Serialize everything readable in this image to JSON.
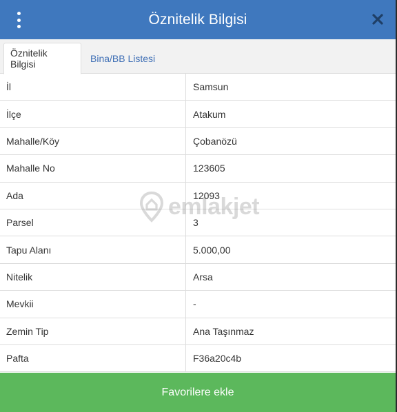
{
  "header": {
    "title": "Öznitelik Bilgisi",
    "menu_icon": "vertical-dots-icon",
    "close_icon": "close-icon",
    "color": "#3f78be"
  },
  "tabs": [
    {
      "label": "Öznitelik Bilgisi",
      "active": true
    },
    {
      "label": "Bina/BB Listesi",
      "active": false
    }
  ],
  "attributes": [
    {
      "label": "İl",
      "value": "Samsun"
    },
    {
      "label": "İlçe",
      "value": "Atakum"
    },
    {
      "label": "Mahalle/Köy",
      "value": "Çobanözü"
    },
    {
      "label": "Mahalle No",
      "value": "123605"
    },
    {
      "label": "Ada",
      "value": "12093"
    },
    {
      "label": "Parsel",
      "value": "3"
    },
    {
      "label": "Tapu Alanı",
      "value": "5.000,00"
    },
    {
      "label": "Nitelik",
      "value": "Arsa"
    },
    {
      "label": "Mevkii",
      "value": "-"
    },
    {
      "label": "Zemin Tip",
      "value": "Ana Taşınmaz"
    },
    {
      "label": "Pafta",
      "value": "F36a20c4b"
    }
  ],
  "watermark": {
    "text": "emlakjet",
    "icon": "location-pin-icon"
  },
  "footer": {
    "button_label": "Favorilere ekle",
    "color": "#5cb85c"
  }
}
